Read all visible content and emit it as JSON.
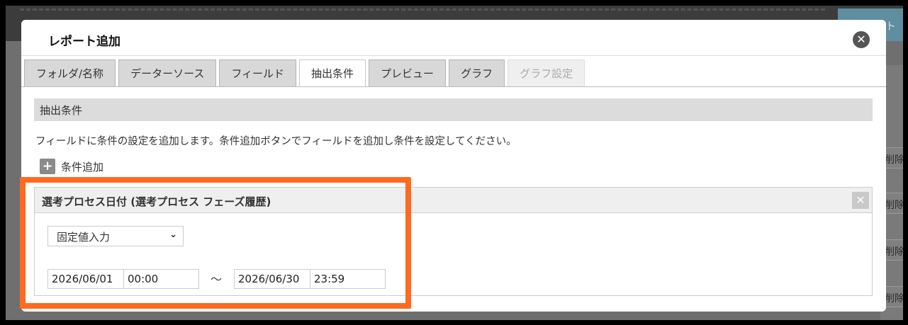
{
  "backdrop": {
    "corner_label": "ート",
    "row_label": "削除"
  },
  "modal": {
    "title": "レポート追加",
    "close_label": "✕"
  },
  "tabs": [
    {
      "label": "フォルダ/名称",
      "state": "normal"
    },
    {
      "label": "データーソース",
      "state": "normal"
    },
    {
      "label": "フィールド",
      "state": "normal"
    },
    {
      "label": "抽出条件",
      "state": "active"
    },
    {
      "label": "プレビュー",
      "state": "normal"
    },
    {
      "label": "グラフ",
      "state": "normal"
    },
    {
      "label": "グラフ設定",
      "state": "disabled"
    }
  ],
  "section": {
    "header": "抽出条件",
    "description": "フィールドに条件の設定を追加します。条件追加ボタンでフィールドを追加し条件を設定してください。",
    "add_label": "条件追加",
    "add_icon": "plus-icon"
  },
  "condition": {
    "title": "選考プロセス日付 (選考プロセス フェーズ履歴)",
    "remove_label": "✕",
    "mode": "固定値入力",
    "chevron": "⌄",
    "from_date": "2026/06/01",
    "from_time": "00:00",
    "separator": "〜",
    "to_date": "2026/06/30",
    "to_time": "23:59"
  },
  "colors": {
    "highlight": "#ff6a21",
    "active_tab": "#ffffff",
    "section_header": "#dcdcdc"
  }
}
